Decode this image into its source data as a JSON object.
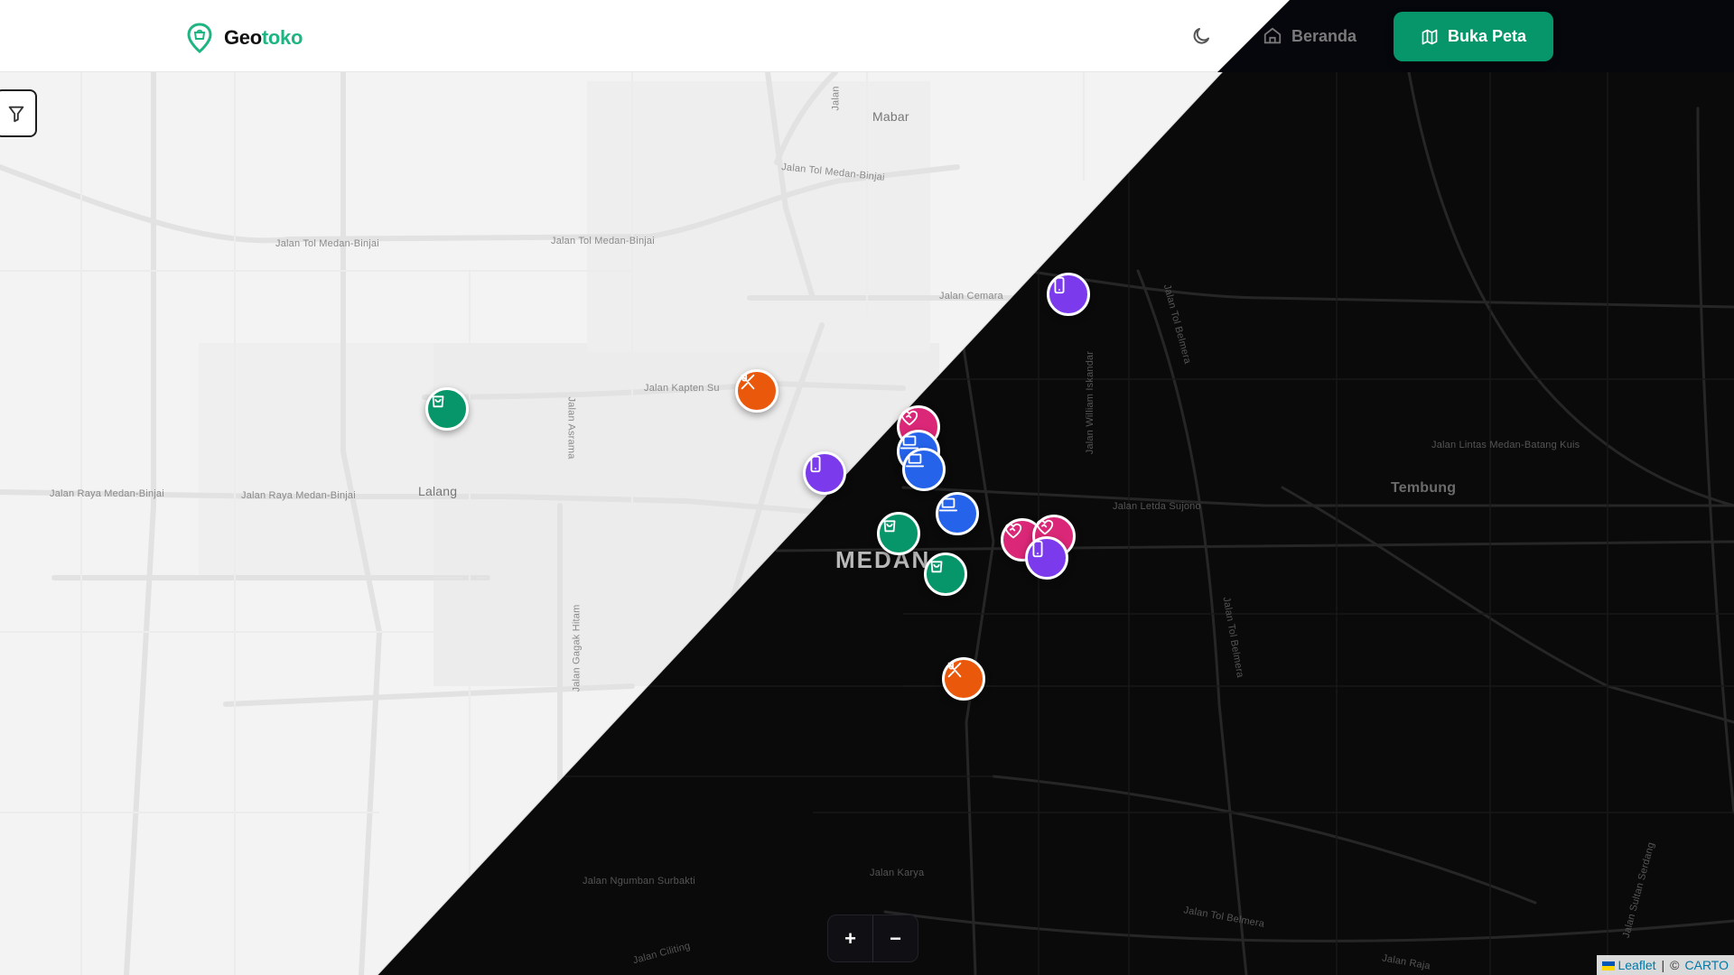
{
  "brand": {
    "name_part1": "Geo",
    "name_part2": "toko",
    "accent_color": "#1fb583"
  },
  "nav": {
    "home_label": "Beranda",
    "open_map_label": "Buka Peta",
    "primary_color": "#079669"
  },
  "map": {
    "place_labels": {
      "mabar": "Mabar",
      "lalang": "Lalang",
      "tembung": "Tembung",
      "medan": "MEDAN"
    },
    "street_labels": {
      "tol_medan_binjai_1": "Jalan Tol Medan-Binjai",
      "tol_medan_binjai_2": "Jalan Tol Medan-Binjai",
      "tol_medan_binjai_3": "Jalan Tol Medan-Binjai",
      "cemara": "Jalan Cemara",
      "kapten": "Jalan Kapten Su",
      "raya_medan_binjai_1": "Jalan Raya Medan-Binjai",
      "raya_medan_binjai_2": "Jalan Raya Medan-Binjai",
      "asrama": "Jalan Asrama",
      "gagak_hitam": "Jalan Gagak Hitam",
      "ngumban_surbakti": "Jalan Ngumban Surbakti",
      "karya_jaya": "Jalan Karya",
      "letda_sujono": "Jalan Letda Sujono",
      "lintas": "Jalan Lintas Medan-Batang Kuis",
      "william_iskandar": "Jalan William Iskandar",
      "tol_belmera_1": "Jalan Tol Belmera",
      "tol_belmera_2": "Jalan Tol Belmera",
      "sultan_serdang": "Jalan Sultan Serdang",
      "ciliting": "Jalan Ciliting",
      "raja": "Jalan Raja",
      "tol_belmera_3": "Jalan Tol Belmera",
      "jalan_top": "Jalan"
    },
    "markers": [
      {
        "category": "shop",
        "color": "#079669",
        "icon": "shopping-bag-icon"
      },
      {
        "category": "food",
        "color": "#ea580c",
        "icon": "utensils-icon"
      },
      {
        "category": "phone",
        "color": "#7c3aed",
        "icon": "smartphone-icon"
      },
      {
        "category": "phone",
        "color": "#7c3aed",
        "icon": "smartphone-icon"
      },
      {
        "category": "health",
        "color": "#db2777",
        "icon": "heart-handshake-icon"
      },
      {
        "category": "computer",
        "color": "#2563eb",
        "icon": "laptop-icon"
      },
      {
        "category": "computer",
        "color": "#2563eb",
        "icon": "laptop-icon"
      },
      {
        "category": "computer",
        "color": "#2563eb",
        "icon": "laptop-icon"
      },
      {
        "category": "shop",
        "color": "#079669",
        "icon": "shopping-bag-icon"
      },
      {
        "category": "shop",
        "color": "#079669",
        "icon": "shopping-bag-icon"
      },
      {
        "category": "health",
        "color": "#db2777",
        "icon": "heart-handshake-icon"
      },
      {
        "category": "health",
        "color": "#db2777",
        "icon": "heart-handshake-icon"
      },
      {
        "category": "phone",
        "color": "#7c3aed",
        "icon": "smartphone-icon"
      },
      {
        "category": "food",
        "color": "#ea580c",
        "icon": "utensils-icon"
      }
    ]
  },
  "zoom": {
    "in_label": "+",
    "out_label": "−"
  },
  "attribution": {
    "leaflet": "Leaflet",
    "separator": "|",
    "copyright": "©",
    "carto": "CARTO"
  }
}
